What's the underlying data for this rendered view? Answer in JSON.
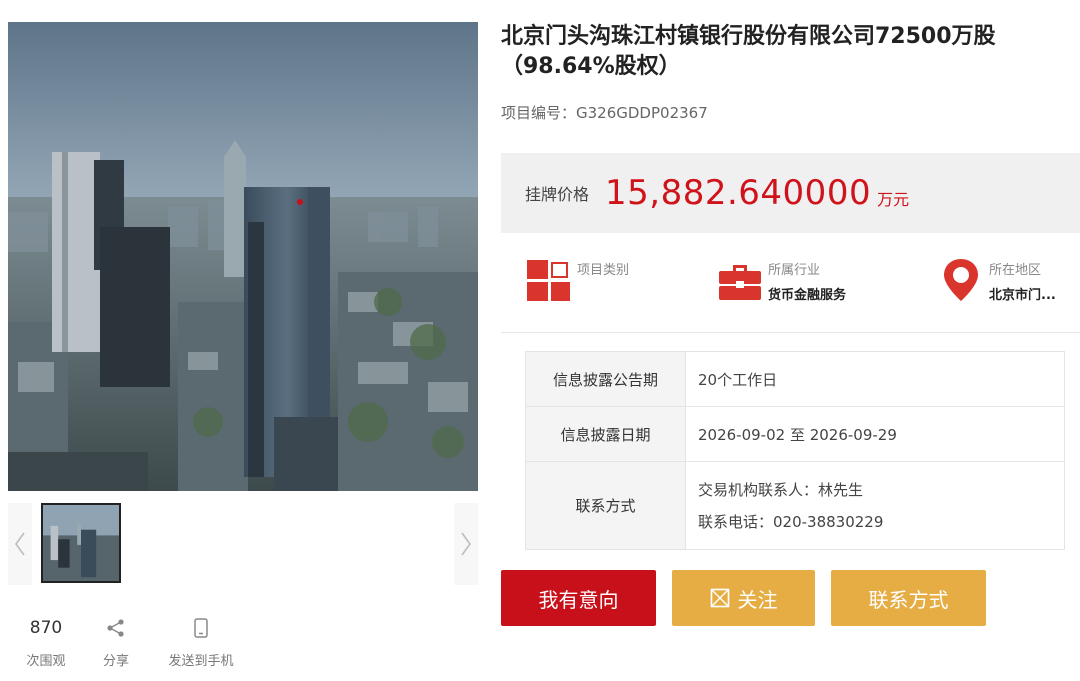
{
  "listing": {
    "title": "北京门头沟珠江村镇银行股份有限公司72500万股（98.64%股权）",
    "project_no": "项目编号：G326GDDP02367"
  },
  "price": {
    "label": "挂牌价格",
    "value": "15,882.640000",
    "unit": "万元",
    "color": "#d0121b"
  },
  "attributes": [
    {
      "label": "项目类别",
      "value": "",
      "icon": "grid-icon"
    },
    {
      "label": "所属行业",
      "value": "货币金融服务",
      "icon": "briefcase-icon"
    },
    {
      "label": "所在地区",
      "value": "北京市门...",
      "icon": "location-pin-icon"
    }
  ],
  "info_table": [
    {
      "key": "信息披露公告期",
      "value": "20个工作日"
    },
    {
      "key": "信息披露日期",
      "value": "2026-09-02 至 2026-09-29"
    },
    {
      "key": "联系方式",
      "lines": [
        "交易机构联系人：林先生",
        "联系电话：020-38830229"
      ]
    }
  ],
  "buttons": {
    "intent": "我有意向",
    "follow": "关注",
    "contact": "联系方式"
  },
  "stats": {
    "views_count": "870",
    "views_label": "次围观",
    "share_label": "分享",
    "send_label": "发送到手机"
  },
  "colors": {
    "primary_red": "#c8101a",
    "gold": "#e6ad45"
  }
}
